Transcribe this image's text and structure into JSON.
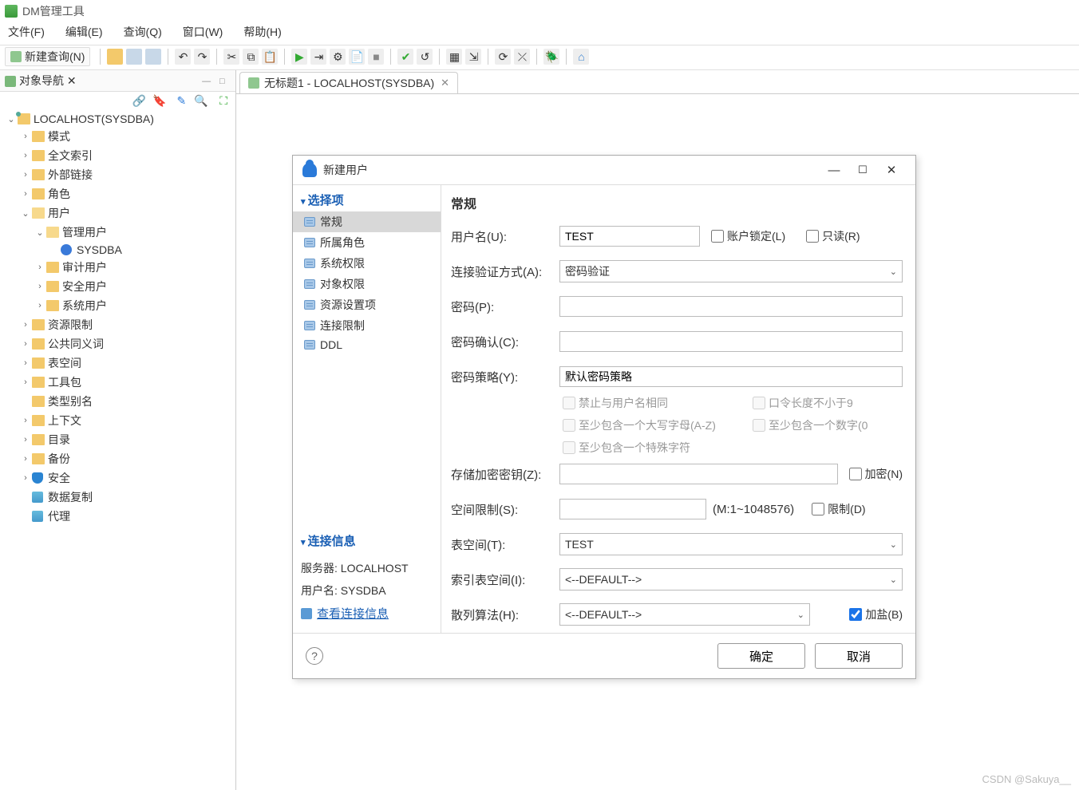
{
  "app": {
    "title": "DM管理工具"
  },
  "menu": {
    "file": "文件(F)",
    "edit": "编辑(E)",
    "query": "查询(Q)",
    "window": "窗口(W)",
    "help": "帮助(H)"
  },
  "toolbar": {
    "new_query": "新建查询(N)"
  },
  "nav": {
    "title": "对象导航",
    "root": "LOCALHOST(SYSDBA)",
    "items": {
      "schema": "模式",
      "fulltext": "全文索引",
      "extlink": "外部链接",
      "role": "角色",
      "user": "用户",
      "manage_user": "管理用户",
      "sysdba": "SYSDBA",
      "audit_user": "审计用户",
      "security_user": "安全用户",
      "system_user": "系统用户",
      "resource_limit": "资源限制",
      "public_synonym": "公共同义词",
      "tablespace": "表空间",
      "toolkit": "工具包",
      "type_alias": "类型别名",
      "context": "上下文",
      "directory": "目录",
      "backup": "备份",
      "security": "安全",
      "replication": "数据复制",
      "agent": "代理"
    }
  },
  "editor_tab": {
    "title": "无标题1 - LOCALHOST(SYSDBA)"
  },
  "dialog": {
    "title": "新建用户",
    "section_options": "选择项",
    "options": {
      "general": "常规",
      "roles": "所属角色",
      "sys_priv": "系统权限",
      "obj_priv": "对象权限",
      "resource": "资源设置项",
      "conn_limit": "连接限制",
      "ddl": "DDL"
    },
    "section_conn": "连接信息",
    "conn": {
      "server_label": "服务器: ",
      "server_value": "LOCALHOST",
      "user_label": "用户名: ",
      "user_value": "SYSDBA",
      "view_link": "查看连接信息"
    },
    "page_title": "常规",
    "form": {
      "username_label": "用户名(U):",
      "username_value": "TEST",
      "lock_label": "账户锁定(L)",
      "readonly_label": "只读(R)",
      "auth_label": "连接验证方式(A):",
      "auth_value": "密码验证",
      "pwd_label": "密码(P):",
      "pwd_confirm_label": "密码确认(C):",
      "pwd_policy_label": "密码策略(Y):",
      "pwd_policy_value": "默认密码策略",
      "p1": "禁止与用户名相同",
      "p2": "口令长度不小于9",
      "p3": "至少包含一个大写字母(A-Z)",
      "p4": "至少包含一个数字(0",
      "p5": "至少包含一个特殊字符",
      "enc_key_label": "存储加密密钥(Z):",
      "encrypt_label": "加密(N)",
      "space_limit_label": "空间限制(S):",
      "space_hint": "(M:1~1048576)",
      "limit_label": "限制(D)",
      "ts_label": "表空间(T):",
      "ts_value": "TEST",
      "idx_ts_label": "索引表空间(I):",
      "idx_ts_value": "<--DEFAULT-->",
      "hash_label": "散列算法(H):",
      "hash_value": "<--DEFAULT-->",
      "salt_label": "加盐(B)"
    },
    "buttons": {
      "ok": "确定",
      "cancel": "取消"
    }
  },
  "watermark": "CSDN @Sakuya__"
}
